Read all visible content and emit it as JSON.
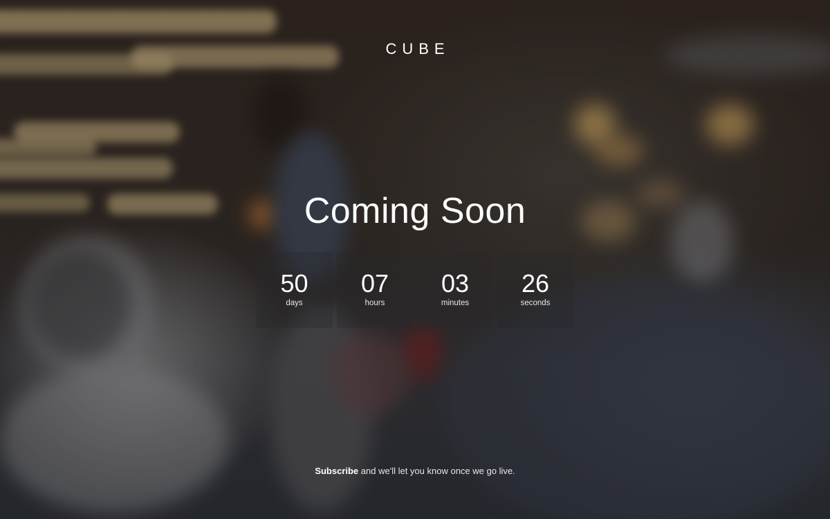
{
  "brand": {
    "logo_text": "CUBE"
  },
  "hero": {
    "title": "Coming Soon"
  },
  "countdown": [
    {
      "value": "50",
      "unit": "days"
    },
    {
      "value": "07",
      "unit": "hours"
    },
    {
      "value": "03",
      "unit": "minutes"
    },
    {
      "value": "26",
      "unit": "seconds"
    }
  ],
  "footer": {
    "subscribe_link": "Subscribe",
    "message": "and we'll let you know once we go live."
  },
  "colors": {
    "text": "#ffffff",
    "tile_bg": "rgba(40,40,44,0.35)"
  }
}
